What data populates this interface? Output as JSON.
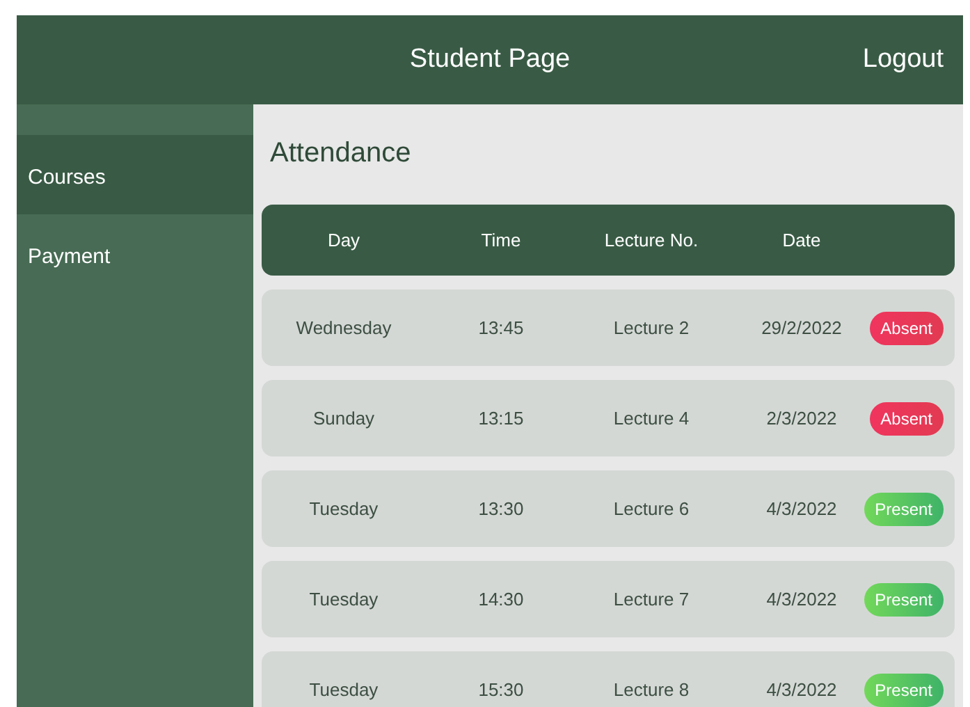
{
  "header": {
    "title": "Student Page",
    "logout": "Logout"
  },
  "sidebar": {
    "items": [
      {
        "label": "Courses",
        "selected": true
      },
      {
        "label": "Payment",
        "selected": false
      }
    ]
  },
  "section_title": "Attendance",
  "table": {
    "columns": [
      "Day",
      "Time",
      "Lecture No.",
      "Date"
    ],
    "rows": [
      {
        "day": "Wednesday",
        "time": "13:45",
        "lecture": "Lecture 2",
        "date": "29/2/2022",
        "status": {
          "kind": "absent",
          "label": "Absent"
        }
      },
      {
        "day": "Sunday",
        "time": "13:15",
        "lecture": "Lecture 4",
        "date": "2/3/2022",
        "status": {
          "kind": "absent",
          "label": "Absent"
        }
      },
      {
        "day": "Tuesday",
        "time": "13:30",
        "lecture": "Lecture 6",
        "date": "4/3/2022",
        "status": {
          "kind": "present",
          "label": "Present"
        }
      },
      {
        "day": "Tuesday",
        "time": "14:30",
        "lecture": "Lecture 7",
        "date": "4/3/2022",
        "status": {
          "kind": "present",
          "label": "Present"
        }
      },
      {
        "day": "Tuesday",
        "time": "15:30",
        "lecture": "Lecture 8",
        "date": "4/3/2022",
        "status": {
          "kind": "present",
          "label": "Present"
        }
      }
    ]
  }
}
